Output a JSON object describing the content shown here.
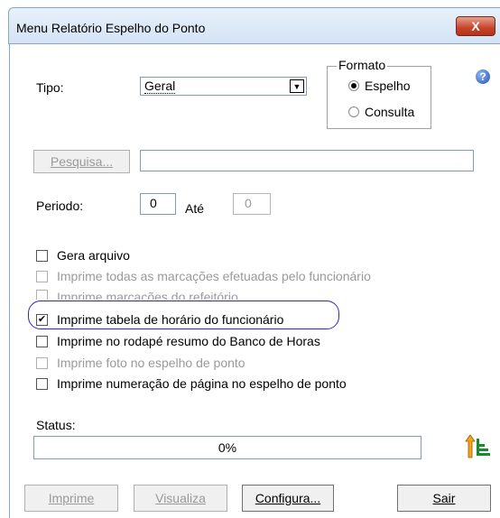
{
  "window": {
    "title": "Menu Relatório Espelho do Ponto",
    "close_glyph": "X"
  },
  "tipo": {
    "label": "Tipo:",
    "value": "Geral"
  },
  "formato": {
    "legend": "Formato",
    "options": [
      {
        "label": "Espelho",
        "selected": true
      },
      {
        "label": "Consulta",
        "selected": false
      }
    ]
  },
  "help_glyph": "?",
  "pesquisa": {
    "button": "Pesquisa...",
    "value": ""
  },
  "periodo": {
    "label": "Periodo:",
    "from": "0",
    "ate_label": "Até",
    "to": "0"
  },
  "options": [
    {
      "label": "Gera arquivo",
      "checked": false,
      "enabled": true
    },
    {
      "label": "Imprime todas as marcações efetuadas pelo funcionário",
      "checked": false,
      "enabled": false
    },
    {
      "label": "Imprime marcações do refeitório",
      "checked": false,
      "enabled": false
    },
    {
      "label": "Imprime tabela de horário do funcionário",
      "checked": true,
      "enabled": true
    },
    {
      "label": "Imprime no rodapé resumo do Banco de Horas",
      "checked": false,
      "enabled": true
    },
    {
      "label": "Imprime foto no espelho de ponto",
      "checked": false,
      "enabled": false
    },
    {
      "label": "Imprime numeração de página no espelho de ponto",
      "checked": false,
      "enabled": true
    }
  ],
  "status": {
    "label": "Status:",
    "progress_text": "0%",
    "progress": 0
  },
  "buttons": {
    "imprime": "Imprime",
    "visualiza": "Visualiza",
    "configura": "Configura...",
    "sair": "Sair"
  },
  "colors": {
    "highlight": "#2a2acb",
    "close": "#c7442a"
  }
}
